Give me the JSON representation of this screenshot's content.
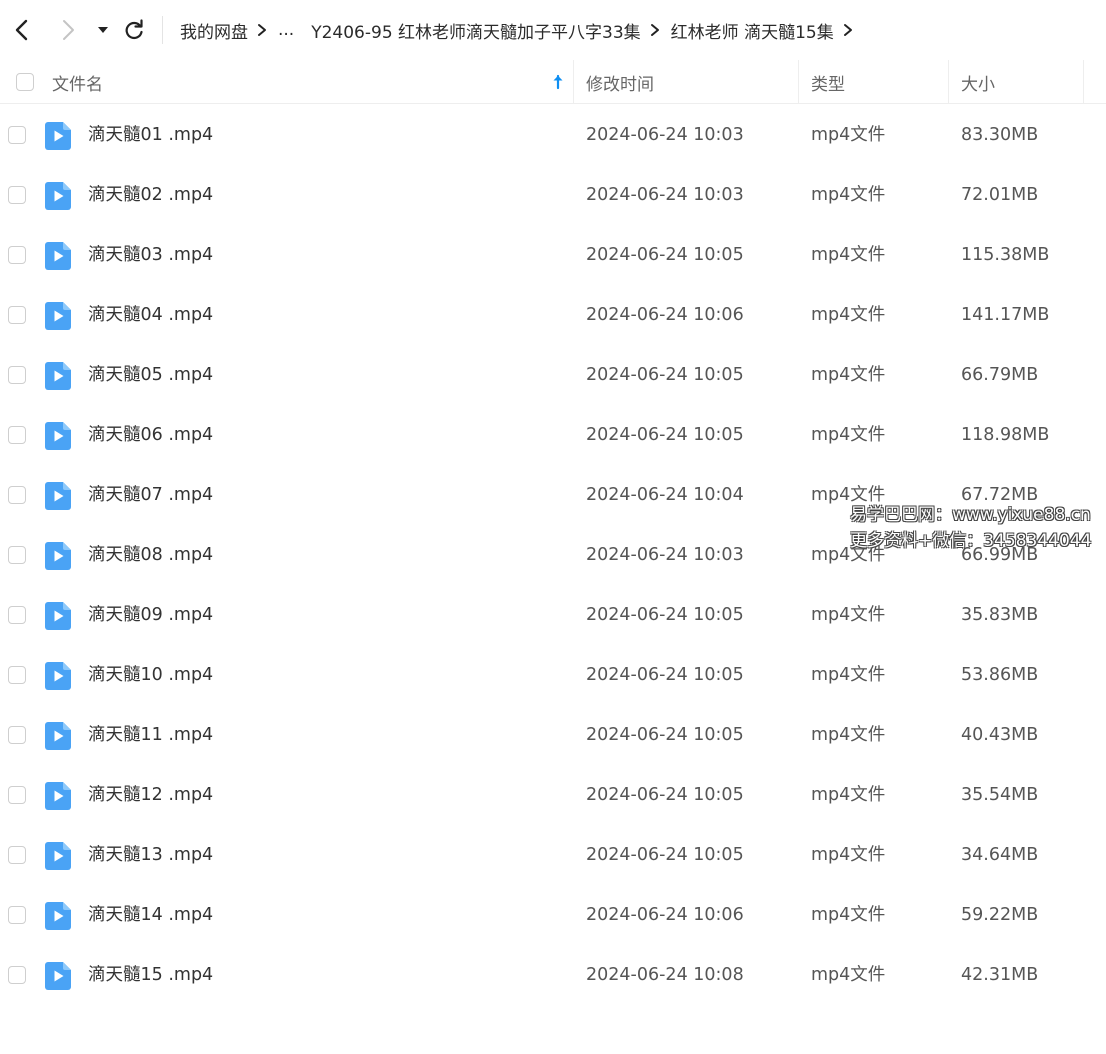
{
  "nav": {
    "back_icon": "chevron-left-icon",
    "forward_icon": "chevron-right-icon",
    "dropdown_icon": "caret-down-icon",
    "refresh_icon": "refresh-icon"
  },
  "breadcrumb": {
    "root": "我的网盘",
    "ellipsis": "...",
    "parent": "Y2406-95 红林老师滴天髓加子平八字33集",
    "current": "红林老师 滴天髓15集"
  },
  "columns": {
    "name": "文件名",
    "modified": "修改时间",
    "type": "类型",
    "size": "大小"
  },
  "sort_icon": "arrow-up-icon",
  "files": [
    {
      "name": "滴天髓01 .mp4",
      "modified": "2024-06-24 10:03",
      "type": "mp4文件",
      "size": "83.30MB"
    },
    {
      "name": "滴天髓02 .mp4",
      "modified": "2024-06-24 10:03",
      "type": "mp4文件",
      "size": "72.01MB"
    },
    {
      "name": "滴天髓03 .mp4",
      "modified": "2024-06-24 10:05",
      "type": "mp4文件",
      "size": "115.38MB"
    },
    {
      "name": "滴天髓04 .mp4",
      "modified": "2024-06-24 10:06",
      "type": "mp4文件",
      "size": "141.17MB"
    },
    {
      "name": "滴天髓05 .mp4",
      "modified": "2024-06-24 10:05",
      "type": "mp4文件",
      "size": "66.79MB"
    },
    {
      "name": "滴天髓06 .mp4",
      "modified": "2024-06-24 10:05",
      "type": "mp4文件",
      "size": "118.98MB"
    },
    {
      "name": "滴天髓07 .mp4",
      "modified": "2024-06-24 10:04",
      "type": "mp4文件",
      "size": "67.72MB"
    },
    {
      "name": "滴天髓08 .mp4",
      "modified": "2024-06-24 10:03",
      "type": "mp4文件",
      "size": "66.99MB"
    },
    {
      "name": "滴天髓09 .mp4",
      "modified": "2024-06-24 10:05",
      "type": "mp4文件",
      "size": "35.83MB"
    },
    {
      "name": "滴天髓10 .mp4",
      "modified": "2024-06-24 10:05",
      "type": "mp4文件",
      "size": "53.86MB"
    },
    {
      "name": "滴天髓11 .mp4",
      "modified": "2024-06-24 10:05",
      "type": "mp4文件",
      "size": "40.43MB"
    },
    {
      "name": "滴天髓12 .mp4",
      "modified": "2024-06-24 10:05",
      "type": "mp4文件",
      "size": "35.54MB"
    },
    {
      "name": "滴天髓13 .mp4",
      "modified": "2024-06-24 10:05",
      "type": "mp4文件",
      "size": "34.64MB"
    },
    {
      "name": "滴天髓14 .mp4",
      "modified": "2024-06-24 10:06",
      "type": "mp4文件",
      "size": "59.22MB"
    },
    {
      "name": "滴天髓15 .mp4",
      "modified": "2024-06-24 10:08",
      "type": "mp4文件",
      "size": "42.31MB"
    }
  ],
  "file_icon": "video-file-icon",
  "colors": {
    "accent": "#0f8ff2",
    "icon_blue": "#4aa3f5"
  },
  "watermark": {
    "line1": "易学巴巴网：www.yixue88.cn",
    "line2": "更多资料+微信：3458344044"
  }
}
